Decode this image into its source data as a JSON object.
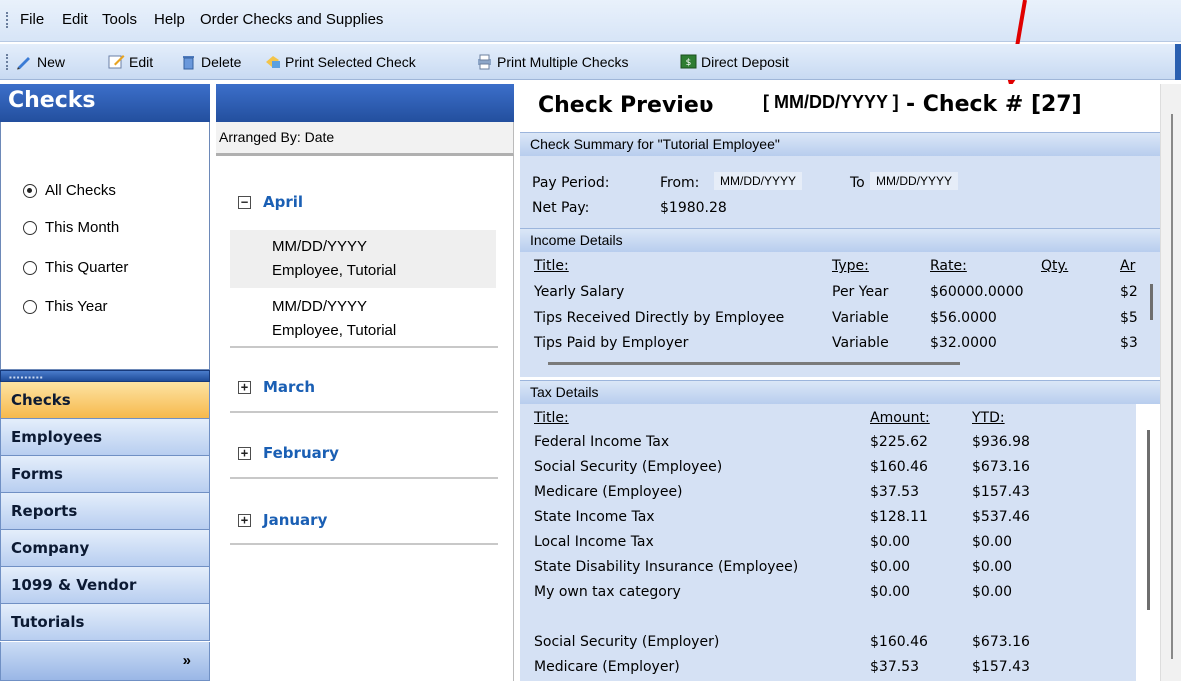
{
  "menu": {
    "items": [
      {
        "label": "File",
        "underline": "F"
      },
      {
        "label": "Edit",
        "underline": "E"
      },
      {
        "label": "Tools",
        "underline": "T"
      },
      {
        "label": "Help",
        "underline": "H"
      },
      {
        "label": "Order Checks and Supplies",
        "underline": "O"
      }
    ]
  },
  "toolbar": {
    "new_label": "New",
    "edit_label": "Edit",
    "delete_label": "Delete",
    "print_selected_label": "Print Selected Check",
    "print_multiple_label": "Print Multiple Checks",
    "direct_deposit_label": "Direct Deposit"
  },
  "left": {
    "title": "Checks",
    "filters": [
      "All Checks",
      "This Month",
      "This Quarter",
      "This Year"
    ],
    "selected_filter": "All Checks",
    "nav": [
      "Checks",
      "Employees",
      "Forms",
      "Reports",
      "Company",
      "1099 & Vendor",
      "Tutorials"
    ],
    "active_nav": "Checks"
  },
  "middle": {
    "arranged_by": "Arranged By: Date",
    "months": [
      {
        "name": "April",
        "expanded": true,
        "checks": [
          {
            "date": "MM/DD/YYYY",
            "name": "Employee, Tutorial",
            "selected": true
          },
          {
            "date": "MM/DD/YYYY",
            "name": "Employee, Tutorial",
            "selected": false
          }
        ]
      },
      {
        "name": "March",
        "expanded": false
      },
      {
        "name": "February",
        "expanded": false
      },
      {
        "name": "January",
        "expanded": false
      }
    ]
  },
  "preview": {
    "title_prefix": "Check Previeʋ",
    "date": "[ MM/DD/YYYY ]",
    "check_num": "- Check # [27]",
    "summary_header": "Check Summary for \"Tutorial Employee\"",
    "pay_period_label": "Pay Period:",
    "from_label": "From:",
    "from_value": "MM/DD/YYYY",
    "to_label": "To",
    "to_value": "MM/DD/YYYY",
    "net_pay_label": "Net Pay:",
    "net_pay_value": "$1980.28",
    "income": {
      "header": "Income Details",
      "columns": [
        "Title:",
        "Type:",
        "Rate:",
        "Qty.",
        "Ar"
      ],
      "rows": [
        {
          "title": "Yearly Salary",
          "type": "Per Year",
          "rate": "$60000.0000",
          "qty": "",
          "amt": "$2"
        },
        {
          "title": "Tips Received Directly by Employee",
          "type": "Variable",
          "rate": "$56.0000",
          "qty": "",
          "amt": "$5"
        },
        {
          "title": "Tips Paid by Employer",
          "type": "Variable",
          "rate": "$32.0000",
          "qty": "",
          "amt": "$3"
        }
      ]
    },
    "tax": {
      "header": "Tax Details",
      "columns": [
        "Title:",
        "Amount:",
        "YTD:"
      ],
      "rows": [
        {
          "title": "Federal Income Tax",
          "amount": "$225.62",
          "ytd": "$936.98"
        },
        {
          "title": "Social Security (Employee)",
          "amount": "$160.46",
          "ytd": "$673.16"
        },
        {
          "title": "Medicare (Employee)",
          "amount": "$37.53",
          "ytd": "$157.43"
        },
        {
          "title": "State Income Tax",
          "amount": "$128.11",
          "ytd": "$537.46"
        },
        {
          "title": "Local Income Tax",
          "amount": "$0.00",
          "ytd": "$0.00"
        },
        {
          "title": "State Disability Insurance (Employee)",
          "amount": "$0.00",
          "ytd": "$0.00"
        },
        {
          "title": "My own tax category",
          "amount": "$0.00",
          "ytd": "$0.00"
        },
        {
          "title": "",
          "amount": "",
          "ytd": ""
        },
        {
          "title": "Social Security (Employer)",
          "amount": "$160.46",
          "ytd": "$673.16"
        },
        {
          "title": "Medicare (Employer)",
          "amount": "$37.53",
          "ytd": "$157.43"
        }
      ]
    }
  },
  "colors": {
    "header_blue": "#234f9e",
    "active_nav": "#f6b94c",
    "section_blue": "#d5e1f4",
    "link_blue": "#1a5fb4",
    "annotation_red": "#e00000"
  }
}
